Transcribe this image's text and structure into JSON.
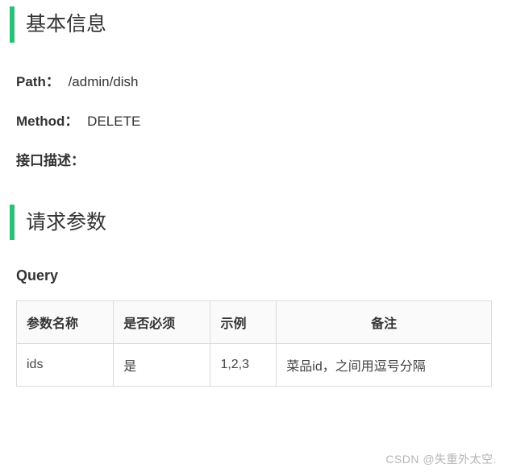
{
  "sections": {
    "basic_info": {
      "heading": "基本信息",
      "path_label": "Path：",
      "path_value": "/admin/dish",
      "method_label": "Method：",
      "method_value": "DELETE",
      "desc_label": "接口描述：",
      "desc_value": ""
    },
    "request_params": {
      "heading": "请求参数",
      "query_label": "Query",
      "table": {
        "headers": {
          "name": "参数名称",
          "required": "是否必须",
          "example": "示例",
          "remark": "备注"
        },
        "rows": [
          {
            "name": "ids",
            "required": "是",
            "example": "1,2,3",
            "remark": "菜品id，之间用逗号分隔"
          }
        ]
      }
    }
  },
  "watermark": "CSDN @失重外太空."
}
